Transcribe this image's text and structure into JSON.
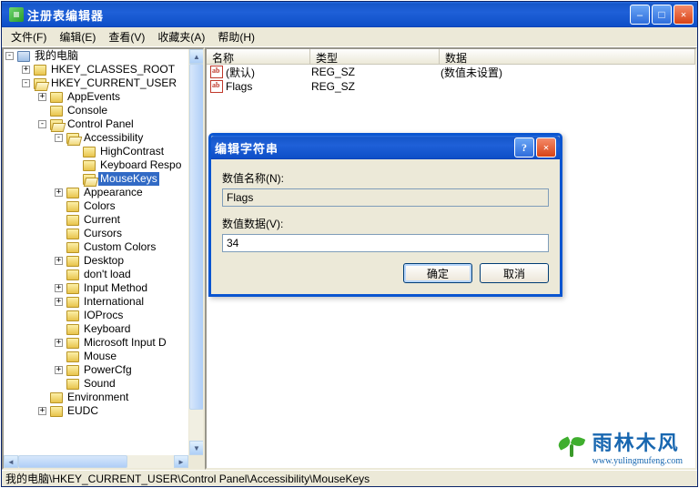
{
  "window": {
    "title": "注册表编辑器",
    "min_symbol": "–",
    "max_symbol": "□",
    "close_symbol": "×"
  },
  "menu": {
    "file": "文件(F)",
    "edit": "编辑(E)",
    "view": "查看(V)",
    "favorites": "收藏夹(A)",
    "help": "帮助(H)"
  },
  "columns": {
    "name": "名称",
    "type": "类型",
    "data": "数据"
  },
  "rows": [
    {
      "name": "(默认)",
      "type": "REG_SZ",
      "data": "(数值未设置)"
    },
    {
      "name": "Flags",
      "type": "REG_SZ",
      "data": ""
    }
  ],
  "tree": {
    "root": "我的电脑",
    "hkcr": "HKEY_CLASSES_ROOT",
    "hkcu": "HKEY_CURRENT_USER",
    "appevents": "AppEvents",
    "console": "Console",
    "controlpanel": "Control Panel",
    "accessibility": "Accessibility",
    "highcontrast": "HighContrast",
    "keyboardresp": "Keyboard Respo",
    "mousekeys": "MouseKeys",
    "appearance": "Appearance",
    "colors": "Colors",
    "current": "Current",
    "cursors": "Cursors",
    "customcolors": "Custom Colors",
    "desktop": "Desktop",
    "dontload": "don't load",
    "inputmethod": "Input Method",
    "international": "International",
    "ioprocs": "IOProcs",
    "keyboard": "Keyboard",
    "msinput": "Microsoft Input D",
    "mouse": "Mouse",
    "powercfg": "PowerCfg",
    "sound": "Sound",
    "environment": "Environment",
    "eudc": "EUDC"
  },
  "dialog": {
    "title": "编辑字符串",
    "help": "?",
    "close": "×",
    "name_label": "数值名称(N):",
    "name_value": "Flags",
    "data_label": "数值数据(V):",
    "data_value": "34",
    "ok": "确定",
    "cancel": "取消"
  },
  "statusbar": "我的电脑\\HKEY_CURRENT_USER\\Control Panel\\Accessibility\\MouseKeys",
  "watermark": {
    "cn": "雨林木风",
    "url": "www.yulingmufeng.com"
  }
}
